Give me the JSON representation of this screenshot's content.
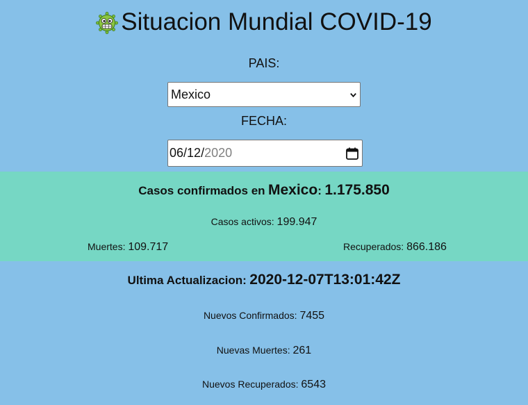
{
  "header": {
    "title": "Situacion Mundial COVID-19",
    "icon": "virus-icon"
  },
  "form": {
    "country_label": "PAIS:",
    "country_value": "Mexico",
    "date_label": "FECHA:",
    "date_value_month": "06",
    "date_value_day": "12",
    "date_value_year": "2020"
  },
  "summary": {
    "confirmed_prefix": "Casos confirmados en",
    "country": "Mexico",
    "confirmed_value": "1.175.850",
    "active_label": "Casos activos:",
    "active_value": "199.947",
    "deaths_label": "Muertes:",
    "deaths_value": "109.717",
    "recovered_label": "Recuperados:",
    "recovered_value": "866.186"
  },
  "update": {
    "label": "Ultima Actualizacion:",
    "value": "2020-12-07T13:01:42Z",
    "new_confirmed_label": "Nuevos Confirmados:",
    "new_confirmed_value": "7455",
    "new_deaths_label": "Nuevas Muertes:",
    "new_deaths_value": "261",
    "new_recovered_label": "Nuevos Recuperados:",
    "new_recovered_value": "6543"
  },
  "colors": {
    "background": "#86c0e8",
    "panel": "#76d7c4"
  }
}
